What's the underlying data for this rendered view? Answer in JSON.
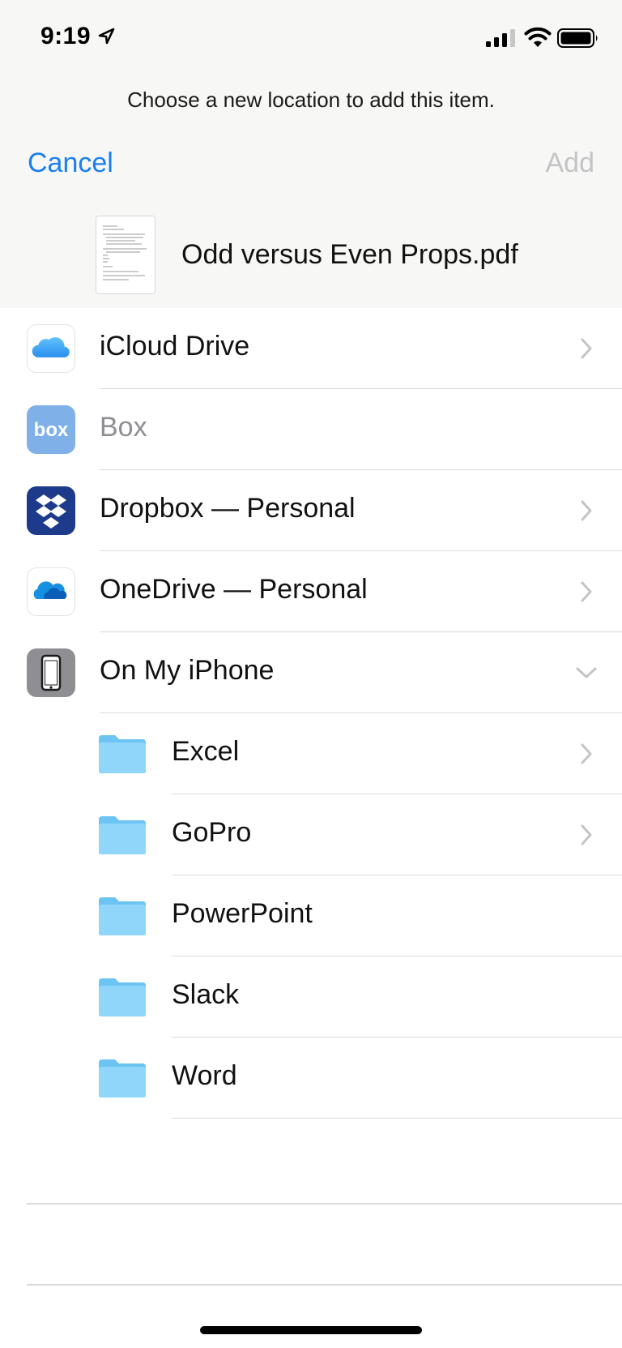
{
  "status_bar": {
    "time": "9:19"
  },
  "header": {
    "prompt": "Choose a new location to add this item.",
    "cancel_label": "Cancel",
    "add_label": "Add"
  },
  "document": {
    "file_name": "Odd versus Even Props.pdf"
  },
  "locations": [
    {
      "label": "iCloud Drive",
      "icon": "icloud-icon",
      "chevron": "right",
      "enabled": true
    },
    {
      "label": "Box",
      "icon": "box-icon",
      "chevron": "none",
      "enabled": false
    },
    {
      "label": "Dropbox — Personal",
      "icon": "dropbox-icon",
      "chevron": "right",
      "enabled": true
    },
    {
      "label": "OneDrive — Personal",
      "icon": "onedrive-icon",
      "chevron": "right",
      "enabled": true
    },
    {
      "label": "On My iPhone",
      "icon": "iphone-icon",
      "chevron": "down",
      "enabled": true
    }
  ],
  "folders": [
    {
      "label": "Excel",
      "icon": "folder-icon",
      "chevron": "right"
    },
    {
      "label": "GoPro",
      "icon": "folder-icon",
      "chevron": "right"
    },
    {
      "label": "PowerPoint",
      "icon": "folder-icon",
      "chevron": "none"
    },
    {
      "label": "Slack",
      "icon": "folder-icon",
      "chevron": "none"
    },
    {
      "label": "Word",
      "icon": "folder-icon",
      "chevron": "none"
    }
  ],
  "colors": {
    "accent": "#1a7ff0",
    "disabled": "#c4c4c6",
    "header_bg": "#f7f7f5",
    "folder": "#7fcff7",
    "dropbox": "#1e3a8a",
    "box": "#7fb0e8"
  }
}
